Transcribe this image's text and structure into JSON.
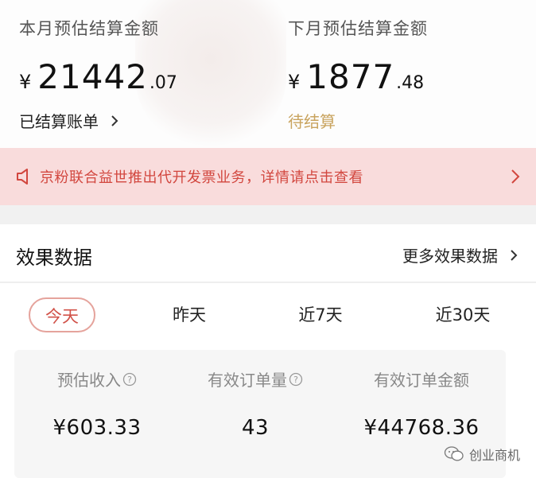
{
  "current_month": {
    "title": "本月预估结算金额",
    "currency": "¥",
    "amount_int": "21442",
    "amount_dec": ".07",
    "link_label": "已结算账单"
  },
  "next_month": {
    "title": "下月预估结算金额",
    "currency": "¥",
    "amount_int": "1877",
    "amount_dec": ".48",
    "status_label": "待结算"
  },
  "notice": {
    "text": "京粉联合益世推出代开发票业务，详情请点击查看"
  },
  "effect": {
    "title": "效果数据",
    "more_label": "更多效果数据",
    "tabs": [
      {
        "label": "今天"
      },
      {
        "label": "昨天"
      },
      {
        "label": "近7天"
      },
      {
        "label": "近30天"
      }
    ],
    "stats": [
      {
        "label": "预估收入",
        "value": "¥603.33"
      },
      {
        "label": "有效订单量",
        "value": "43"
      },
      {
        "label": "有效订单金额",
        "value": "¥44768.36"
      }
    ]
  },
  "watermark": {
    "text": "创业商机"
  },
  "colors": {
    "accent": "#d15249",
    "notice_bg": "#f9dcdc",
    "pending": "#c9a45f"
  }
}
